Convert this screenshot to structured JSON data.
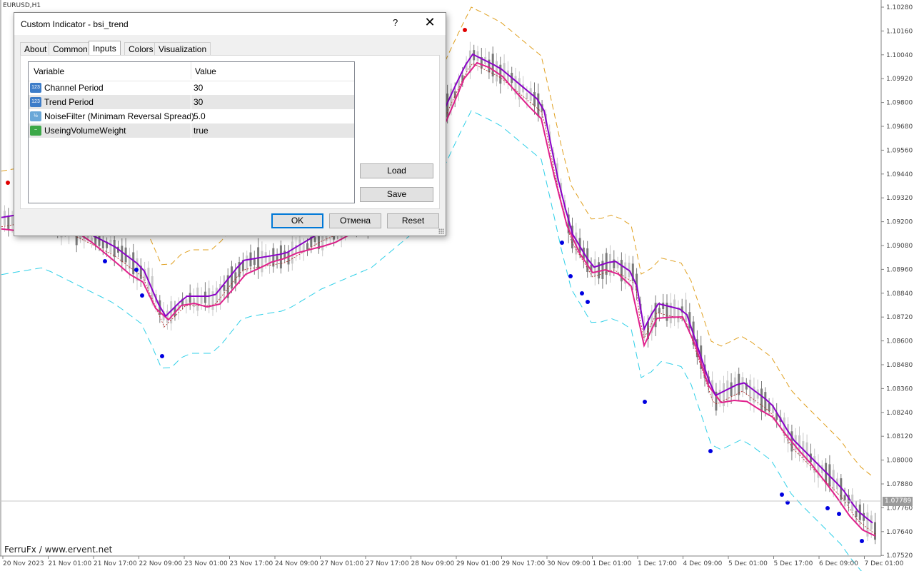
{
  "chart": {
    "symbol": "EURUSD,H1",
    "watermark": "FerruFx / www.ervent.net",
    "current_price": "1.07789",
    "price_axis": [
      "1.10280",
      "1.10160",
      "1.10040",
      "1.09920",
      "1.09800",
      "1.09680",
      "1.09560",
      "1.09440",
      "1.09320",
      "1.09200",
      "1.09080",
      "1.08960",
      "1.08840",
      "1.08720",
      "1.08600",
      "1.08480",
      "1.08360",
      "1.08240",
      "1.08120",
      "1.08000",
      "1.07880",
      "1.07760",
      "1.07640",
      "1.07520"
    ],
    "time_axis": [
      "20 Nov 2023",
      "21 Nov 01:00",
      "21 Nov 17:00",
      "22 Nov 09:00",
      "23 Nov 01:00",
      "23 Nov 17:00",
      "24 Nov 09:00",
      "27 Nov 01:00",
      "27 Nov 17:00",
      "28 Nov 09:00",
      "29 Nov 01:00",
      "29 Nov 17:00",
      "30 Nov 09:00",
      "1 Dec 01:00",
      "1 Dec 17:00",
      "4 Dec 09:00",
      "5 Dec 01:00",
      "5 Dec 17:00",
      "6 Dec 09:00",
      "7 Dec 01:00"
    ],
    "colors": {
      "trend_line": "#8b00c8",
      "channel_line": "#e0208c",
      "upper_band": "#e0a020",
      "lower_band": "#30d0e8",
      "mid_dashed": "#b02020",
      "candle_up": "#c8c8c8",
      "candle_down": "#7a7a7a",
      "buy_dot": "#0000e0",
      "sell_dot": "#e00000"
    }
  },
  "dialog": {
    "title": "Custom Indicator - bsi_trend",
    "help_label": "?",
    "close_label": "✕",
    "tabs": [
      "About",
      "Common",
      "Inputs",
      "Colors",
      "Visualization"
    ],
    "active_tab": "Inputs",
    "grid_headers": {
      "variable": "Variable",
      "value": "Value"
    },
    "params": [
      {
        "name": "Channel Period",
        "value": "30",
        "icon": "int-icon",
        "icon_text": "123"
      },
      {
        "name": "Trend Period",
        "value": "30",
        "icon": "int-icon",
        "icon_text": "123"
      },
      {
        "name": "NoiseFilter (Minimam Reversal Spread)",
        "value": "5.0",
        "icon": "double-icon",
        "icon_text": "½"
      },
      {
        "name": "UseingVolumeWeight",
        "value": "true",
        "icon": "bool-icon",
        "icon_text": "~"
      }
    ],
    "buttons": {
      "load": "Load",
      "save": "Save",
      "ok": "OK",
      "cancel": "Отмена",
      "reset": "Reset"
    }
  }
}
